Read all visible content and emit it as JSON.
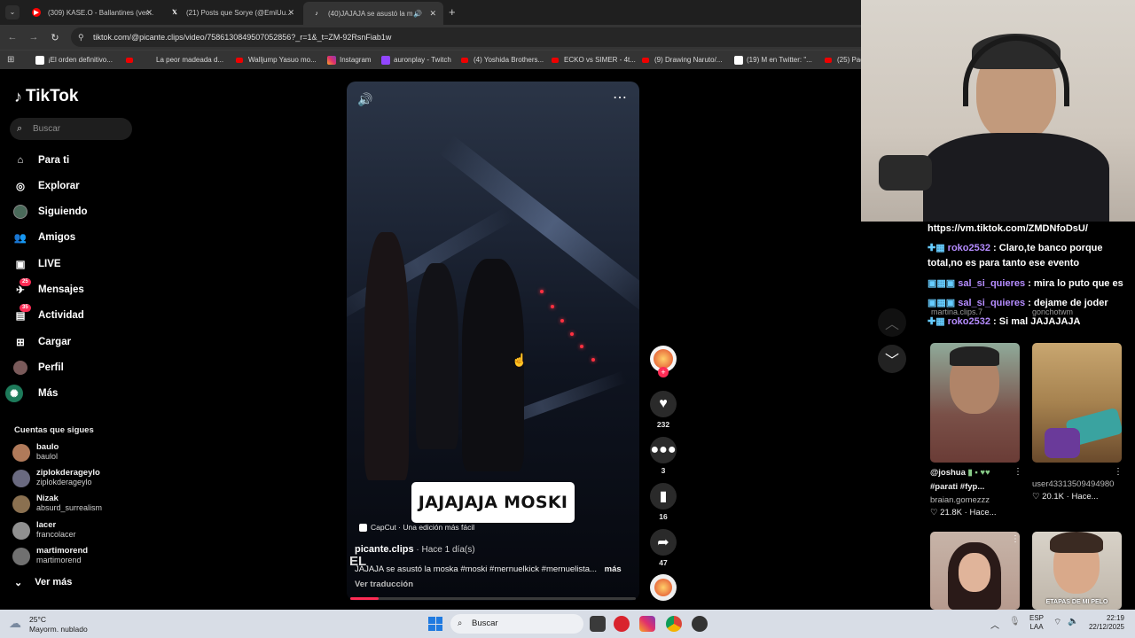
{
  "browser": {
    "tabs": [
      {
        "title": "(309) KASE.O - Ballantines (ver...",
        "icon": "youtube-icon"
      },
      {
        "title": "(21) Posts que Sorye (@EmiUu...",
        "icon": "x-icon"
      },
      {
        "title": "(40)JAJAJA se asustó la mos...",
        "icon": "tiktok-icon"
      }
    ],
    "url": "tiktok.com/@picante.clips/video/7586130849507052856?_r=1&_t=ZM-92RsnFiab1w",
    "bookmarks": [
      "¡El orden definitivo...",
      "La peor madeada d...",
      "Walljump Yasuo mo...",
      "Instagram",
      "auronplay - Twitch",
      "(4) Yoshida Brothers...",
      "ECKO vs SIMER - 4t...",
      "(9) Drawing Naruto/...",
      "(19) M en Twitter: \"...",
      "(25) Pad"
    ]
  },
  "tiktok": {
    "logo": "TikTok",
    "search_placeholder": "Buscar",
    "nav": [
      {
        "label": "Para ti"
      },
      {
        "label": "Explorar"
      },
      {
        "label": "Siguiendo"
      },
      {
        "label": "Amigos"
      },
      {
        "label": "LIVE"
      },
      {
        "label": "Mensajes",
        "badge": "25"
      },
      {
        "label": "Actividad",
        "badge": "35"
      },
      {
        "label": "Cargar"
      },
      {
        "label": "Perfil"
      },
      {
        "label": "Más"
      }
    ],
    "following_title": "Cuentas que sigues",
    "following": [
      {
        "name": "baulo",
        "handle": "baulol"
      },
      {
        "name": "ziplokderageylo",
        "handle": "ziplokderageylo"
      },
      {
        "name": "Nizak",
        "handle": "absurd_surrealism"
      },
      {
        "name": "lacer",
        "handle": "francolacer"
      },
      {
        "name": "martimorend",
        "handle": "martimorend"
      }
    ],
    "see_more": "Ver más",
    "video": {
      "overlay_text": "JAJAJAJA MOSKI",
      "capcut": "CapCut · Una edición más fácil",
      "author": "picante.clips",
      "time_ago": " · Hace 1 día(s)",
      "description": "JAJAJA se asustó la moska #moski #mernuelkick #mernuelista...",
      "more": "más",
      "translate": "Ver traducción",
      "watermark": "EL",
      "progress": 0.1
    },
    "actions": {
      "likes": "232",
      "comments": "3",
      "saves": "16",
      "shares": "47"
    }
  },
  "chat": {
    "lines": [
      {
        "user": "",
        "text": "https://vm.tiktok.com/ZMDNfoDsU/"
      },
      {
        "user": "roko2532",
        "text": " : Claro,te banco porque"
      },
      {
        "user": "",
        "text": "total,no es para tanto ese evento"
      },
      {
        "user": "sal_si_quieres",
        "text": " : mira lo puto que es"
      },
      {
        "user": "sal_si_quieres",
        "text": " : dejame de joder"
      },
      {
        "user": "roko2532",
        "text": " : Si mal JAJAJAJA"
      }
    ],
    "behind": [
      "martina.clips.7",
      "gonchotwm"
    ]
  },
  "related": [
    {
      "caption": "@joshua",
      "caption2": "#parati #fyp...",
      "author": "braian.gomezzz",
      "likes": "21.8K",
      "ago": "Hace..."
    },
    {
      "caption": "",
      "caption2": "",
      "author": "user4331350949498​0",
      "likes": "20.1K",
      "ago": "Hace..."
    },
    {
      "caption": "",
      "caption2": "",
      "author": "",
      "likes": "",
      "ago": ""
    },
    {
      "caption": "ETAPAS DE MI PELO",
      "caption2": "",
      "author": "",
      "likes": "",
      "ago": ""
    }
  ],
  "taskbar": {
    "weather_temp": "25°C",
    "weather_desc": "Mayorm. nublado",
    "search": "Buscar",
    "lang": "ESP",
    "lang2": "LAA",
    "time": "22:19",
    "date": "22/12/2025"
  }
}
